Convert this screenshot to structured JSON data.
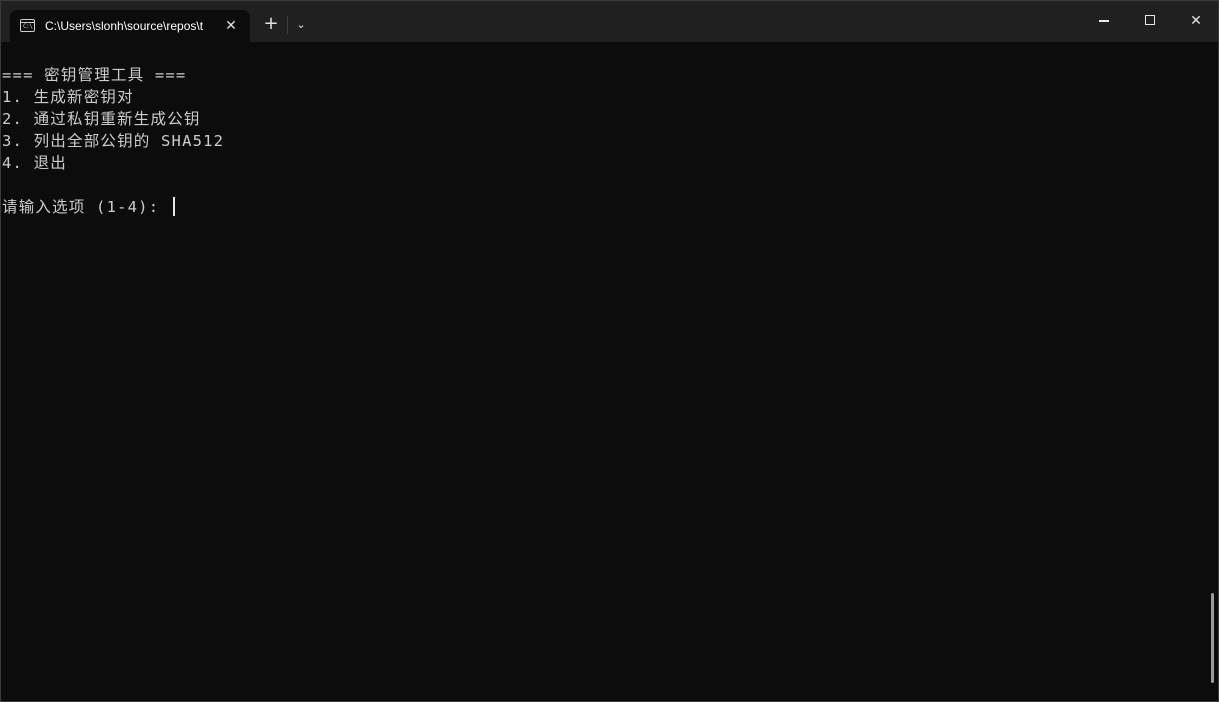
{
  "window": {
    "tab_title": "C:\\Users\\slonh\\source\\repos\\t",
    "tab_icon": "terminal-icon",
    "tab_close_glyph": "✕",
    "new_tab_glyph": "+",
    "dropdown_glyph": "⌄",
    "close_glyph": "✕"
  },
  "terminal": {
    "lines": [
      "=== 密钥管理工具 ===",
      "1. 生成新密钥对",
      "2. 通过私钥重新生成公钥",
      "3. 列出全部公钥的 SHA512",
      "4. 退出"
    ],
    "prompt": "请输入选项 (1-4): "
  },
  "colors": {
    "background": "#0c0c0c",
    "titlebar": "#202020",
    "text": "#cccccc"
  }
}
